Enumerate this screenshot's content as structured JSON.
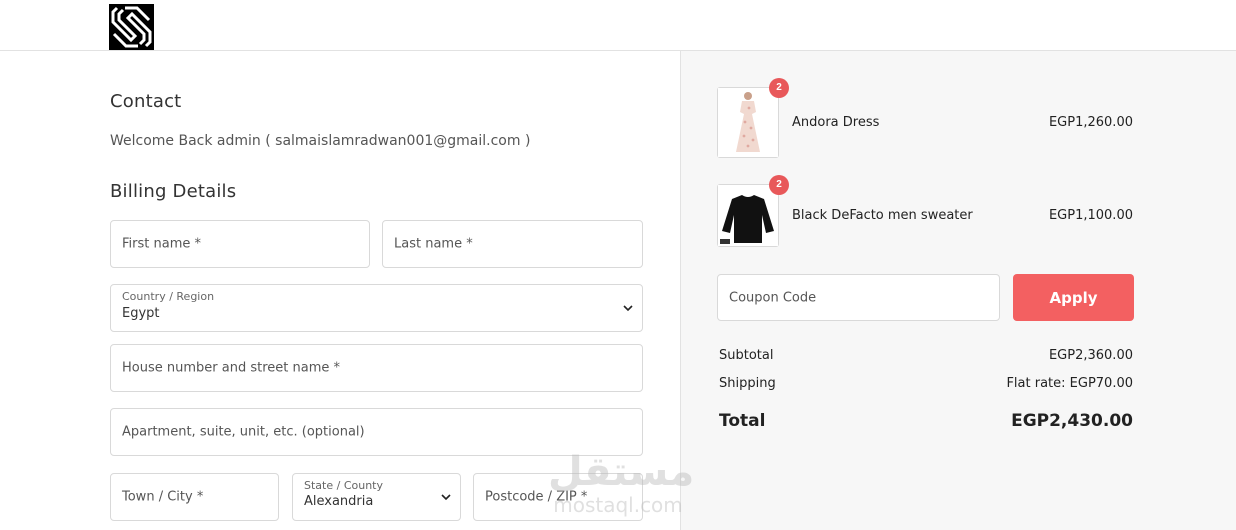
{
  "header": {
    "logo_icon": "store-logo-icon"
  },
  "contact": {
    "title": "Contact",
    "welcome": "Welcome Back admin ( salmaislamradwan001@gmail.com )"
  },
  "billing": {
    "title": "Billing Details",
    "first_name_placeholder": "First name *",
    "last_name_placeholder": "Last name *",
    "country_label": "Country / Region",
    "country_value": "Egypt",
    "street_placeholder": "House number and street name *",
    "apartment_placeholder": "Apartment, suite, unit, etc. (optional)",
    "city_placeholder": "Town / City *",
    "state_label": "State / County",
    "state_value": "Alexandria",
    "postcode_placeholder": "Postcode / ZIP *"
  },
  "cart": {
    "items": [
      {
        "name": "Andora Dress",
        "price": "EGP1,260.00",
        "quantity": "2"
      },
      {
        "name": "Black DeFacto men sweater",
        "price": "EGP1,100.00",
        "quantity": "2"
      }
    ],
    "coupon_placeholder": "Coupon Code",
    "apply_label": "Apply",
    "subtotal_label": "Subtotal",
    "subtotal_value": "EGP2,360.00",
    "shipping_label": "Shipping",
    "shipping_value": "Flat rate: EGP70.00",
    "total_label": "Total",
    "total_value": "EGP2,430.00"
  },
  "watermark": {
    "arabic": "مستقل",
    "latin": "mostaql.com"
  },
  "colors": {
    "accent": "#f36061",
    "badge": "#e8585a",
    "panel_bg": "#f7f7f7",
    "border": "#d9d9d9"
  }
}
